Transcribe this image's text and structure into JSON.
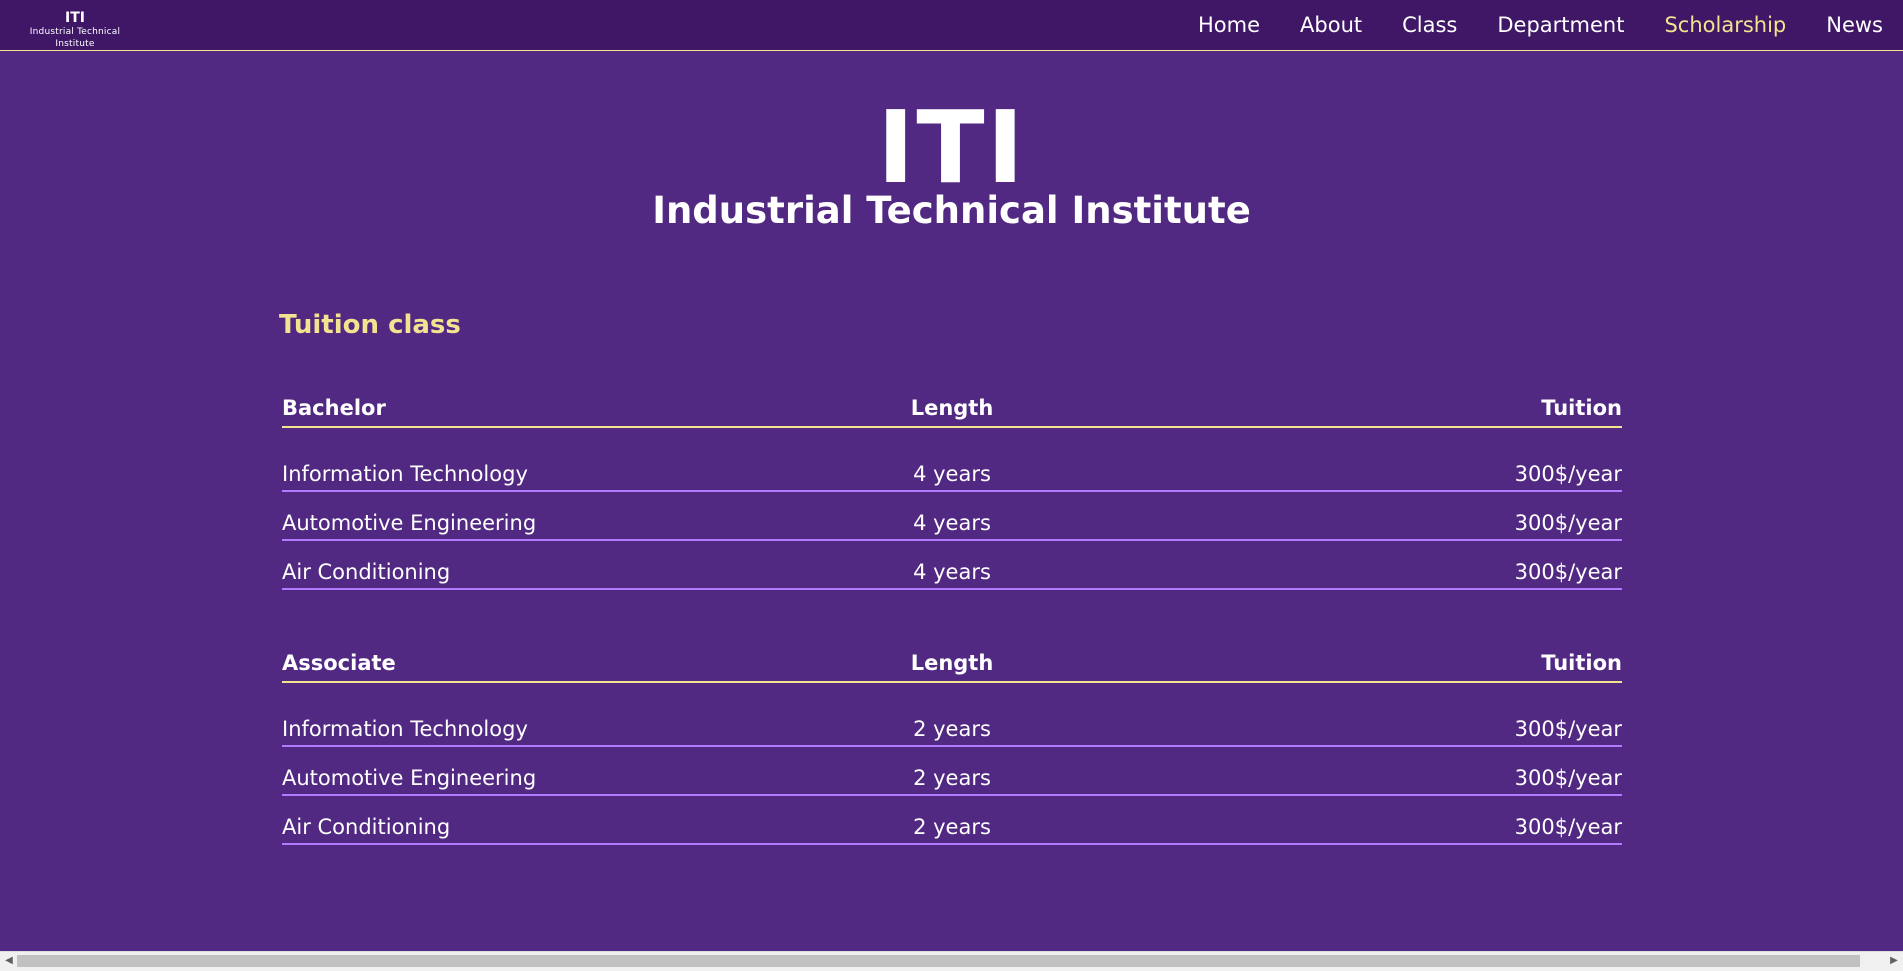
{
  "header": {
    "brand_title": "ITI",
    "brand_subtitle": "Industrial Technical Institute",
    "nav": [
      {
        "label": "Home",
        "active": false
      },
      {
        "label": "About",
        "active": false
      },
      {
        "label": "Class",
        "active": false
      },
      {
        "label": "Department",
        "active": false
      },
      {
        "label": "Scholarship",
        "active": true
      },
      {
        "label": "News",
        "active": false
      }
    ]
  },
  "hero": {
    "title": "ITI",
    "subtitle": "Industrial Technical Institute"
  },
  "section": {
    "title": "Tuition class"
  },
  "tables": {
    "bachelor": {
      "headers": [
        "Bachelor",
        "Length",
        "Tuition"
      ],
      "rows": [
        [
          "Information Technology",
          "4 years",
          "300$/year"
        ],
        [
          "Automotive Engineering",
          "4 years",
          "300$/year"
        ],
        [
          "Air Conditioning",
          "4 years",
          "300$/year"
        ]
      ]
    },
    "associate": {
      "headers": [
        "Associate",
        "Length",
        "Tuition"
      ],
      "rows": [
        [
          "Information Technology",
          "2 years",
          "300$/year"
        ],
        [
          "Automotive Engineering",
          "2 years",
          "300$/year"
        ],
        [
          "Air Conditioning",
          "2 years",
          "300$/year"
        ]
      ]
    }
  },
  "colors": {
    "background": "#512882",
    "topbar": "#3f1766",
    "accent": "#f1e38f",
    "row_divider": "#b27aff"
  },
  "scrollbar": {
    "left_icon": "scroll-left-arrow-icon",
    "right_icon": "scroll-right-arrow-icon"
  }
}
